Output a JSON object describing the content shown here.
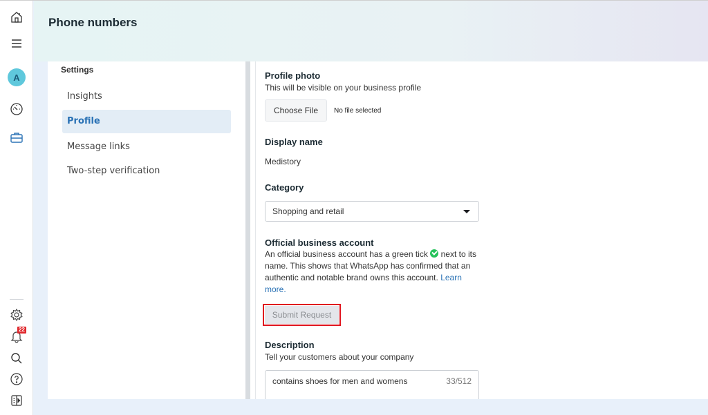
{
  "header": {
    "title": "Phone numbers"
  },
  "rail": {
    "avatar_initial": "A",
    "notification_count": "22",
    "top_icons": [
      "home-icon",
      "menu-icon",
      "dashboard-gauge-icon",
      "briefcase-icon"
    ],
    "bottom_icons": [
      "settings-gear-icon",
      "bell-icon",
      "search-icon",
      "help-icon",
      "panel-toggle-icon"
    ]
  },
  "settings": {
    "title": "Settings",
    "items": [
      {
        "label": "Insights",
        "active": false
      },
      {
        "label": "Profile",
        "active": true
      },
      {
        "label": "Message links",
        "active": false
      },
      {
        "label": "Two-step verification",
        "active": false
      }
    ]
  },
  "profile": {
    "photo_label": "Profile photo",
    "photo_sub": "This will be visible on your business profile",
    "choose_file_label": "Choose File",
    "file_status": "No file selected",
    "display_name_label": "Display name",
    "display_name_value": "Medistory",
    "category_label": "Category",
    "category_value": "Shopping and retail",
    "official_label": "Official business account",
    "official_text_1": "An official business account has a green tick",
    "official_text_2": "next to its name. This shows that WhatsApp has confirmed that an authentic and notable brand owns this account.",
    "learn_more": "Learn more.",
    "submit_label": "Submit Request",
    "description_label": "Description",
    "description_sub": "Tell your customers about your company",
    "description_value": "contains shoes for men and womens",
    "description_counter": "33/512"
  },
  "colors": {
    "accent": "#2a72b5",
    "highlight_border": "#e0141e",
    "tick_green": "#25c25a",
    "badge_red": "#e0262b"
  }
}
